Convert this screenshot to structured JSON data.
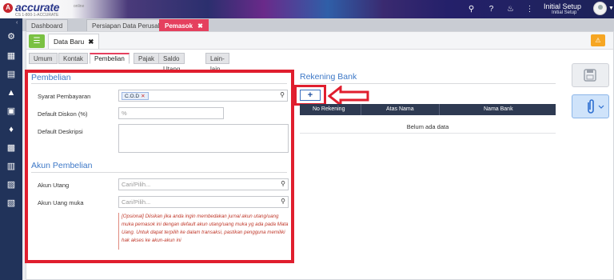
{
  "app": {
    "logo_letter": "A",
    "logo_text": "accurate",
    "logo_sub": "CS 1-800-1-ACCURATE",
    "logo_cloud": "online",
    "user_name": "Initial Setup",
    "user_sub": "Initial Setup"
  },
  "tabs": [
    {
      "label": "Dashboard"
    },
    {
      "label": "Persiapan Data Perusahaan"
    },
    {
      "label": "Pemasok",
      "close": "✖"
    }
  ],
  "doc": {
    "tab_label": "Data Baru",
    "tab_close": "✖"
  },
  "subtabs": [
    "Umum",
    "Kontak",
    "Pembelian",
    "Pajak",
    "Saldo Utang",
    "Lain-lain"
  ],
  "pembelian": {
    "title": "Pembelian",
    "syarat_label": "Syarat Pembayaran",
    "syarat_value": "C.O.D",
    "syarat_remove": "✕",
    "diskon_label": "Default Diskon (%)",
    "diskon_prefix": "%",
    "deskripsi_label": "Default Deskripsi"
  },
  "akun": {
    "title": "Akun Pembelian",
    "utang_label": "Akun Utang",
    "utang_placeholder": "Cari/Pilih...",
    "uangmuka_label": "Akun Uang muka",
    "uangmuka_placeholder": "Cari/Pilih...",
    "note": "[Opsional] Diisikan jika anda ingin membedakan jurnal akun utang/uang muka pemasok ini dengan default akun utang/uang muka yg ada pada Mata Uang. Untuk dapat terpilih ke dalam transaksi, pastikan pengguna memiliki hak akses ke akun-akun ini"
  },
  "rekening": {
    "title": "Rekening Bank",
    "add_label": "+",
    "columns": [
      "No Rekening",
      "Atas Nama",
      "Nama Bank"
    ],
    "empty_text": "Belum ada data"
  },
  "colors": {
    "accent_red": "#e01e2e",
    "tab_active": "#e5405e",
    "link_blue": "#3d78c7",
    "sidebar": "#21335a",
    "grid_header": "#2e3a52"
  },
  "icons": {
    "search": "search-icon",
    "help": "help-icon",
    "bell": "bell-icon",
    "menu": "menu-icon",
    "list": "list-icon",
    "warning": "warning-icon",
    "save": "save-icon",
    "attach": "paperclip-icon"
  }
}
